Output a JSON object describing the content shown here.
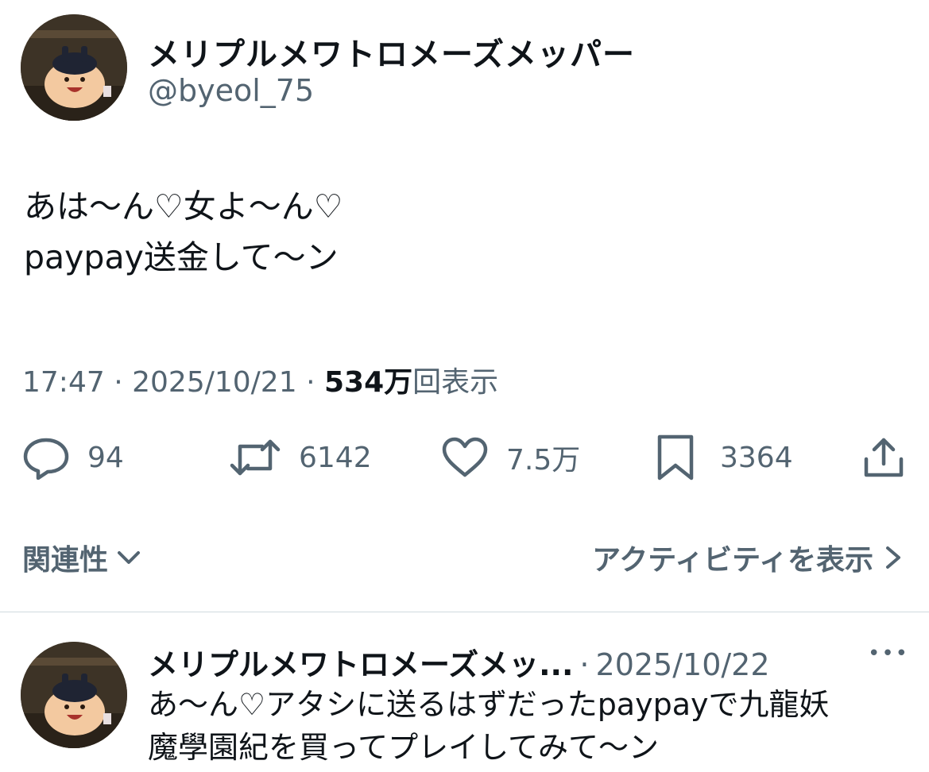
{
  "tweet": {
    "author_name": "メリプルメワトロメーズメッパー",
    "author_handle": "@byeol_75",
    "text_lines": [
      "あは〜ん♡女よ〜ん♡",
      "paypay送金して〜ン"
    ],
    "time": "17:47",
    "separator": "·",
    "date": "2025/10/21",
    "views_count": "534万",
    "views_label": "回表示",
    "actions": {
      "reply_count": "94",
      "retweet_count": "6142",
      "like_count": "7.5万",
      "bookmark_count": "3364"
    },
    "related_label": "関連性",
    "activity_label": "アクティビティを表示"
  },
  "reply": {
    "author_name": "メリプルメワトロメーズメッ...",
    "separator": "·",
    "date": "2025/10/22",
    "more": "•••",
    "text_lines": [
      "あ〜ん♡アタシに送るはずだったpaypayで九龍妖",
      "魔學園紀を買ってプレイしてみて〜ン"
    ]
  },
  "colors": {
    "text_primary": "#0f1419",
    "text_secondary": "#536471",
    "divider": "#cfd9de"
  },
  "icons": [
    "reply-icon",
    "retweet-icon",
    "like-icon",
    "bookmark-icon",
    "share-icon",
    "chevron-down-icon",
    "chevron-right-icon",
    "more-icon"
  ]
}
